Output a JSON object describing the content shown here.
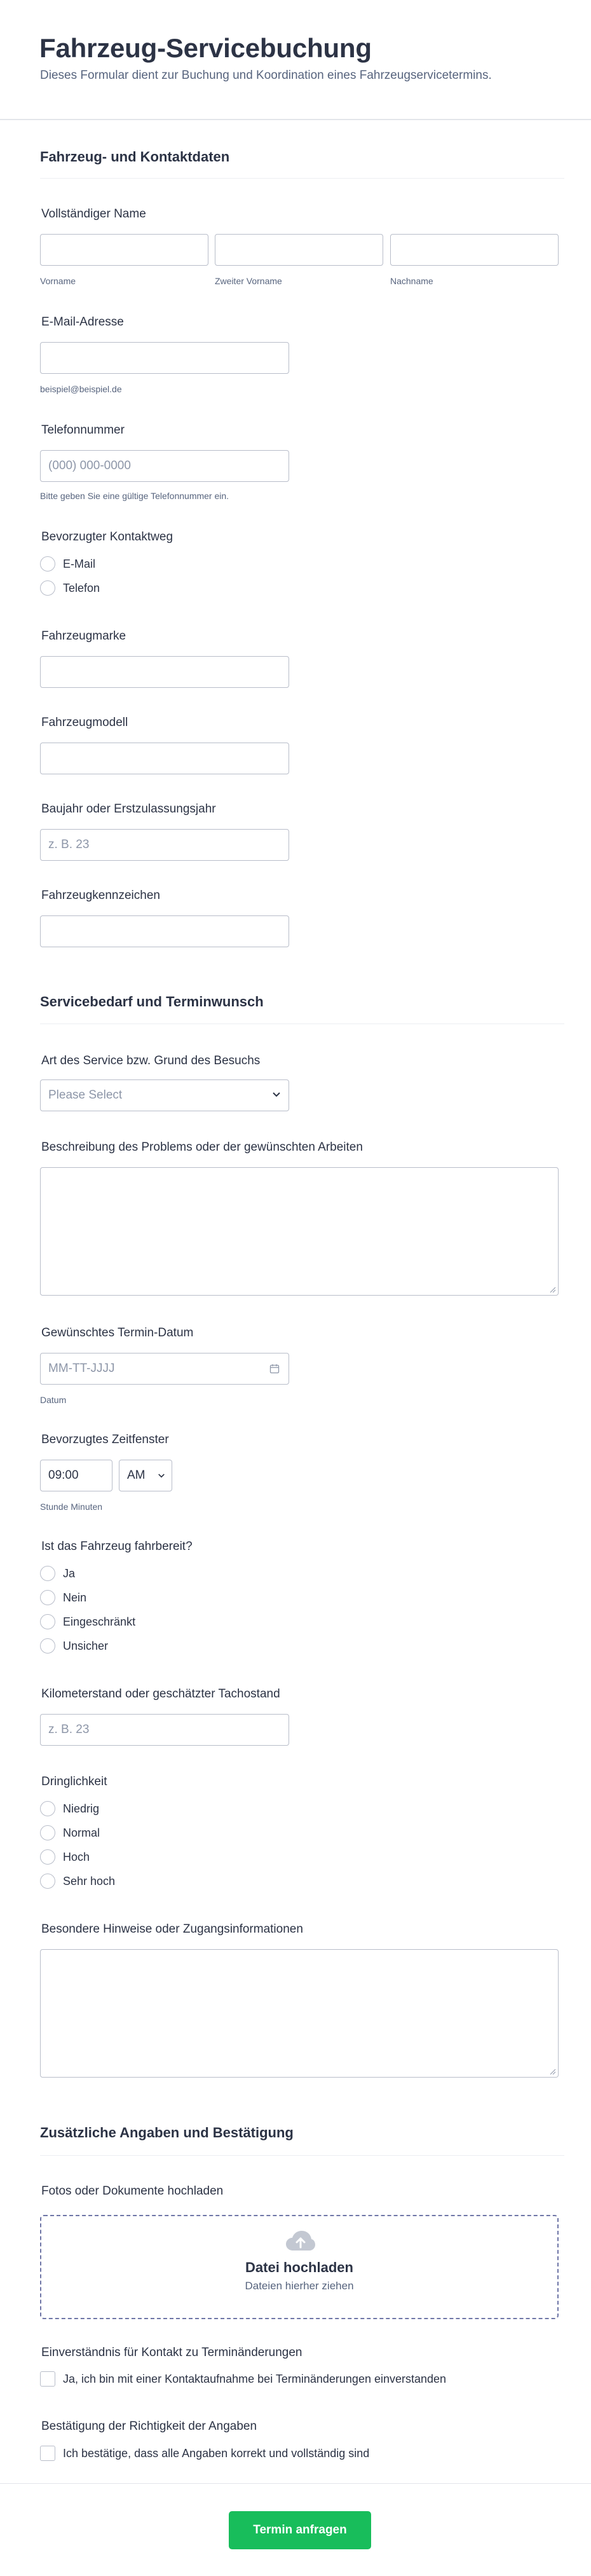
{
  "form": {
    "title": "Fahrzeug-Servicebuchung",
    "subtitle": "Dieses Formular dient zur Buchung und Koordination eines Fahrzeugservicetermins."
  },
  "sections": {
    "s1": "Fahrzeug- und Kontaktdaten",
    "s2": "Servicebedarf und Terminwunsch",
    "s3": "Zusätzliche Angaben und Bestätigung"
  },
  "fields": {
    "full_name": {
      "label": "Vollständiger Name",
      "first": "Vorname",
      "middle": "Zweiter Vorname",
      "last": "Nachname"
    },
    "email": {
      "label": "E-Mail-Adresse",
      "hint": "beispiel@beispiel.de"
    },
    "phone": {
      "label": "Telefonnummer",
      "placeholder": "(000) 000-0000",
      "hint": "Bitte geben Sie eine gültige Telefonnummer ein."
    },
    "contact_method": {
      "label": "Bevorzugter Kontaktweg",
      "options": [
        "E-Mail",
        "Telefon"
      ]
    },
    "make": {
      "label": "Fahrzeugmarke"
    },
    "model": {
      "label": "Fahrzeugmodell"
    },
    "year": {
      "label": "Baujahr oder Erstzulassungsjahr",
      "placeholder": "z. B. 23"
    },
    "plate": {
      "label": "Fahrzeugkennzeichen"
    },
    "service_type": {
      "label": "Art des Service bzw. Grund des Besuchs",
      "placeholder": "Please Select"
    },
    "description": {
      "label": "Beschreibung des Problems oder der gewünschten Arbeiten"
    },
    "date": {
      "label": "Gewünschtes Termin-Datum",
      "placeholder": "MM-TT-JJJJ",
      "hint": "Datum"
    },
    "time": {
      "label": "Bevorzugtes Zeitfenster",
      "value": "09:00",
      "ampm": "AM",
      "hint": "Stunde Minuten"
    },
    "drivable": {
      "label": "Ist das Fahrzeug fahrbereit?",
      "options": [
        "Ja",
        "Nein",
        "Eingeschränkt",
        "Unsicher"
      ]
    },
    "mileage": {
      "label": "Kilometerstand oder geschätzter Tachostand",
      "placeholder": "z. B. 23"
    },
    "urgency": {
      "label": "Dringlichkeit",
      "options": [
        "Niedrig",
        "Normal",
        "Hoch",
        "Sehr hoch"
      ]
    },
    "notes": {
      "label": "Besondere Hinweise oder Zugangsinformationen"
    },
    "upload": {
      "label": "Fotos oder Dokumente hochladen",
      "title": "Datei hochladen",
      "subtitle": "Dateien hierher ziehen"
    },
    "consent": {
      "label": "Einverständnis für Kontakt zu Terminänderungen",
      "text": "Ja, ich bin mit einer Kontaktaufnahme bei Terminänderungen einverstanden"
    },
    "confirm": {
      "label": "Bestätigung der Richtigkeit der Angaben",
      "text": "Ich bestätige, dass alle Angaben korrekt und vollständig sind"
    }
  },
  "submit": {
    "label": "Termin anfragen"
  },
  "colors": {
    "accent": "#18bd5b",
    "text": "#2c3345",
    "muted": "#57647e",
    "border": "#b8bdc9",
    "dropzone_border": "#6f76a7"
  },
  "icons": {
    "dropdown": "chevron-down-icon",
    "date": "calendar-icon",
    "upload": "cloud-upload-icon"
  }
}
